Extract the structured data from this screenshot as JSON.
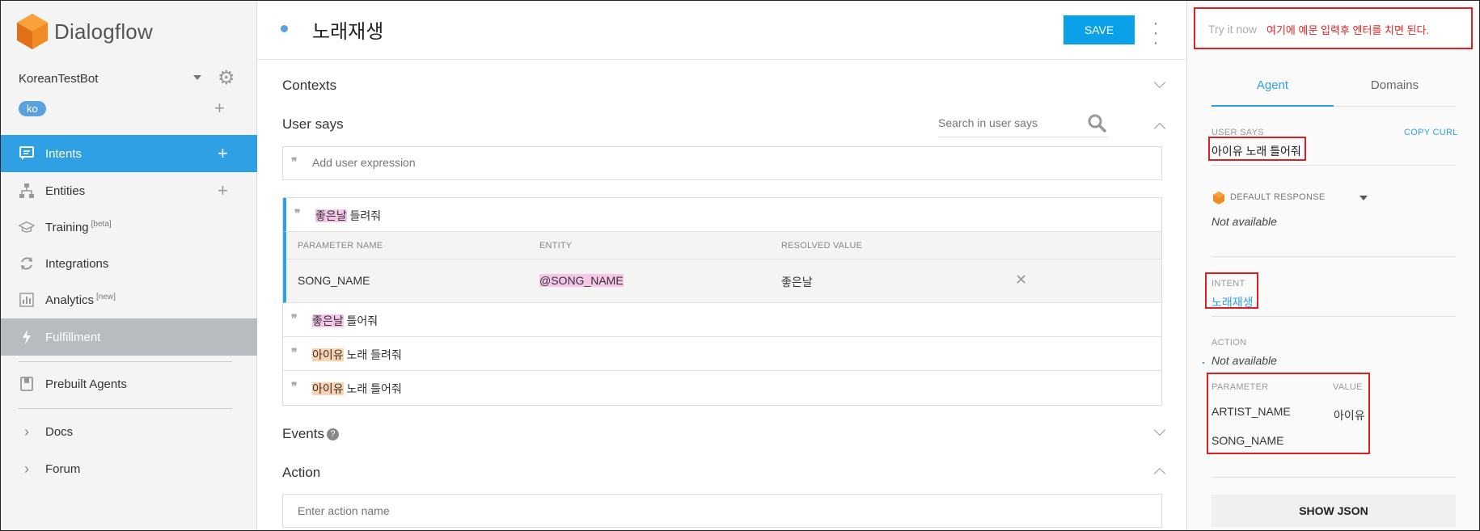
{
  "brand": {
    "name": "Dialogflow"
  },
  "agent": {
    "name": "KoreanTestBot",
    "language": "ko"
  },
  "nav": {
    "intents": "Intents",
    "entities": "Entities",
    "training": "Training",
    "training_tag": "[beta]",
    "integrations": "Integrations",
    "analytics": "Analytics",
    "analytics_tag": "[new]",
    "fulfillment": "Fulfillment",
    "prebuilt": "Prebuilt Agents",
    "docs": "Docs",
    "forum": "Forum"
  },
  "header": {
    "title": "노래재생",
    "save": "SAVE"
  },
  "sections": {
    "contexts": "Contexts",
    "user_says": "User says",
    "events": "Events",
    "action": "Action"
  },
  "user_says": {
    "search_placeholder": "Search in user says",
    "add_placeholder": "Add user expression",
    "expressions": [
      {
        "highlight": "좋은날",
        "rest": " 들려줘",
        "color": "#f5c6e8"
      },
      {
        "highlight": "좋은날",
        "rest": " 틀어줘",
        "color": "#f5c6e8"
      },
      {
        "highlight": "아이유",
        "rest": " 노래 들려줘",
        "color": "#fbd3b0"
      },
      {
        "highlight": "아이유",
        "rest": " 노래 틀어줘",
        "color": "#fbd3b0"
      }
    ],
    "param_headers": {
      "name": "PARAMETER NAME",
      "entity": "ENTITY",
      "resolved": "RESOLVED VALUE"
    },
    "param_row": {
      "name": "SONG_NAME",
      "entity": "@SONG_NAME",
      "resolved": "좋은날"
    }
  },
  "action": {
    "placeholder": "Enter action name"
  },
  "try_it": {
    "placeholder": "Try it now",
    "note": "여기에 예문 입력후 엔터를 치면 된다."
  },
  "tabs": {
    "agent": "Agent",
    "domains": "Domains"
  },
  "result": {
    "user_says_label": "USER SAYS",
    "copy_curl": "COPY CURL",
    "user_says_value": "아이유 노래 틀어줘",
    "default_response": "DEFAULT RESPONSE",
    "response_value": "Not available",
    "intent_label": "INTENT",
    "intent_value": "노래재생",
    "action_label": "ACTION",
    "action_value": "Not available",
    "parameter_label": "PARAMETER",
    "value_label": "VALUE",
    "params": [
      {
        "name": "ARTIST_NAME",
        "value": "아이유"
      },
      {
        "name": "SONG_NAME",
        "value": ""
      }
    ],
    "show_json": "SHOW JSON"
  },
  "colors": {
    "accent": "#2fa0e3",
    "annotation": "#e02020",
    "brand_orange": "#f08a24"
  },
  "icons": [
    "dialogflow-logo-icon",
    "gear-icon",
    "plus-icon",
    "chat-icon",
    "hierarchy-icon",
    "graduation-cap-icon",
    "sync-icon",
    "bar-chart-icon",
    "lightning-icon",
    "book-icon",
    "chevron-right-icon",
    "search-icon",
    "quote-icon",
    "close-icon",
    "help-icon"
  ]
}
